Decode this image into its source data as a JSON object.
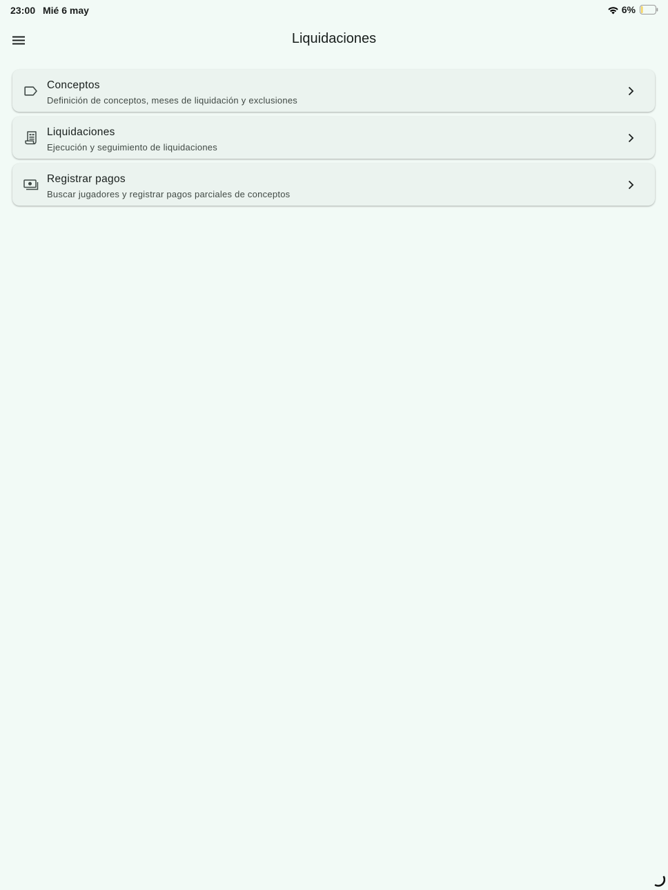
{
  "status_bar": {
    "time": "23:00",
    "date": "Mié 6 may",
    "battery": "6%",
    "wifi_icon": "wifi-icon",
    "battery_icon": "battery-low-icon"
  },
  "app_bar": {
    "title": "Liquidaciones",
    "menu_icon": "hamburger-menu-icon"
  },
  "menu": {
    "items": [
      {
        "icon": "label-tag-icon",
        "title": "Conceptos",
        "subtitle": "Definición de conceptos, meses de liquidación y exclusiones"
      },
      {
        "icon": "receipt-document-icon",
        "title": "Liquidaciones",
        "subtitle": "Ejecución y seguimiento de liquidaciones"
      },
      {
        "icon": "payments-cash-icon",
        "title": "Registrar pagos",
        "subtitle": "Buscar jugadores y registrar pagos parciales de conceptos"
      }
    ]
  },
  "colors": {
    "background": "#f2faf6",
    "card": "#ebf3ef",
    "text_primary": "#171d1b",
    "text_secondary": "#404944",
    "battery_level": "#f4d35e"
  }
}
